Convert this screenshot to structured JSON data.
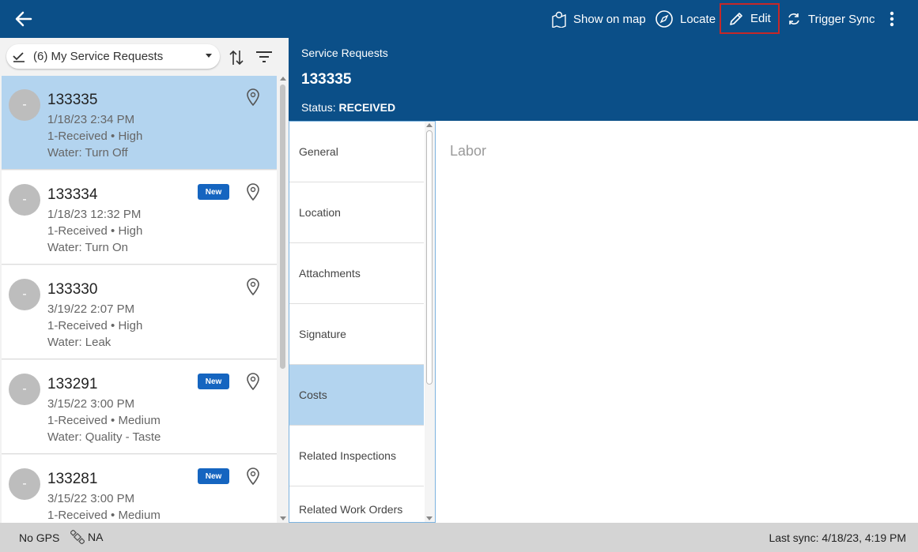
{
  "toolbar": {
    "show_on_map": "Show on map",
    "locate": "Locate",
    "edit": "Edit",
    "trigger_sync": "Trigger Sync"
  },
  "list": {
    "selector_label": "(6) My Service Requests",
    "items": [
      {
        "avatar": "-",
        "id": "133335",
        "date": "1/18/23 2:34 PM",
        "status": "1-Received • High",
        "type": "Water: Turn Off",
        "new": "",
        "selected": true
      },
      {
        "avatar": "-",
        "id": "133334",
        "date": "1/18/23 12:32 PM",
        "status": "1-Received • High",
        "type": "Water: Turn On",
        "new": "New",
        "selected": false
      },
      {
        "avatar": "-",
        "id": "133330",
        "date": "3/19/22 2:07 PM",
        "status": "1-Received • High",
        "type": "Water: Leak",
        "new": "",
        "selected": false
      },
      {
        "avatar": "-",
        "id": "133291",
        "date": "3/15/22 3:00 PM",
        "status": "1-Received • Medium",
        "type": "Water: Quality - Taste",
        "new": "New",
        "selected": false
      },
      {
        "avatar": "-",
        "id": "133281",
        "date": "3/15/22 3:00 PM",
        "status": "1-Received • Medium",
        "type": "",
        "new": "New",
        "selected": false
      }
    ]
  },
  "detail": {
    "breadcrumb": "Service Requests",
    "title": "133335",
    "status_label": "Status:",
    "status_value": "RECEIVED"
  },
  "sections": [
    {
      "label": "General",
      "active": false
    },
    {
      "label": "Location",
      "active": false
    },
    {
      "label": "Attachments",
      "active": false
    },
    {
      "label": "Signature",
      "active": false
    },
    {
      "label": "Costs",
      "active": true
    },
    {
      "label": "Related Inspections",
      "active": false
    },
    {
      "label": "Related Work Orders",
      "active": false
    }
  ],
  "content": {
    "heading": "Labor"
  },
  "statusbar": {
    "gps": "No GPS",
    "network": "NA",
    "last_sync": "Last sync: 4/18/23, 4:19 PM"
  },
  "colors": {
    "header_blue": "#0b4f88",
    "selected_blue": "#b3d4ef",
    "badge_blue": "#1565c0",
    "edit_highlight": "#c62828"
  }
}
